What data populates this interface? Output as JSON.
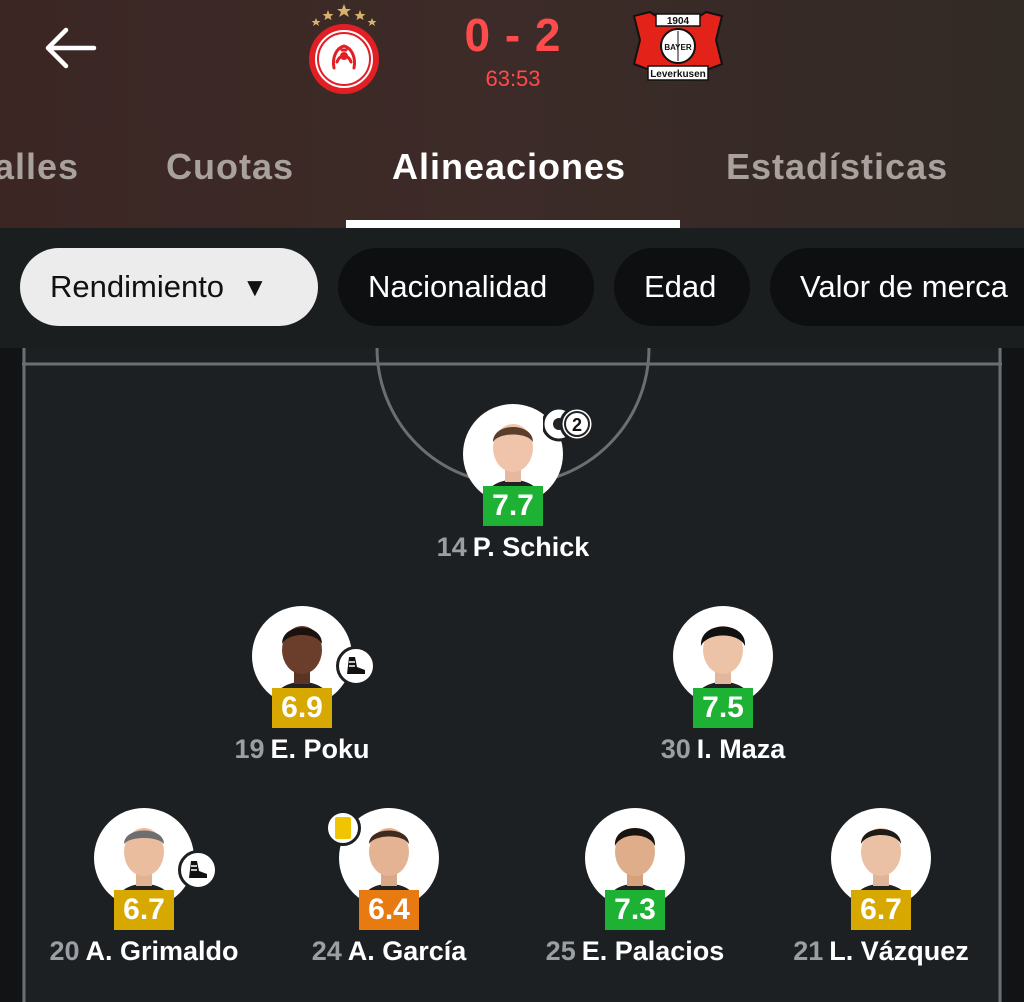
{
  "match": {
    "score": "0 - 2",
    "clock": "63:53",
    "home_team": "Olympiacos",
    "away_team": "Bayer Leverkusen",
    "away_crest_year": "1904",
    "away_crest_word": "BAYER",
    "away_crest_city": "Leverkusen"
  },
  "tabs": [
    {
      "label": "alles",
      "active": false
    },
    {
      "label": "Cuotas",
      "active": false
    },
    {
      "label": "Alineaciones",
      "active": true
    },
    {
      "label": "Estadísticas",
      "active": false
    }
  ],
  "filters": [
    {
      "label": "Rendimiento",
      "selected": true,
      "caret": "▼"
    },
    {
      "label": "Nacionalidad",
      "selected": false
    },
    {
      "label": "Edad",
      "selected": false
    },
    {
      "label": "Valor de merca",
      "selected": false
    }
  ],
  "players": [
    {
      "number": "14",
      "name": "P. Schick",
      "rating": "7.7",
      "rating_color": "#1db233",
      "goals": "2"
    },
    {
      "number": "19",
      "name": "E. Poku",
      "rating": "6.9",
      "rating_color": "#d6a800",
      "assist": true
    },
    {
      "number": "30",
      "name": "I. Maza",
      "rating": "7.5",
      "rating_color": "#1db233"
    },
    {
      "number": "20",
      "name": "A. Grimaldo",
      "rating": "6.7",
      "rating_color": "#d6a800",
      "assist": true
    },
    {
      "number": "24",
      "name": "A. García",
      "rating": "6.4",
      "rating_color": "#e87a12",
      "yellow_card": true
    },
    {
      "number": "25",
      "name": "E. Palacios",
      "rating": "7.3",
      "rating_color": "#1db233"
    },
    {
      "number": "21",
      "name": "L. Vázquez",
      "rating": "6.7",
      "rating_color": "#d6a800"
    }
  ],
  "colors": {
    "score_red": "#ff4b4b",
    "rating_green": "#1db233",
    "rating_yellow": "#d6a800",
    "rating_orange": "#e87a12"
  }
}
